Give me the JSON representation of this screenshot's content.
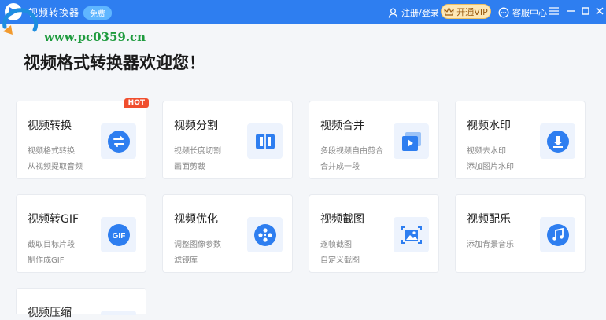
{
  "titlebar": {
    "app_title": "视频转换器",
    "version_badge": "免费",
    "login_label": "注册/登录",
    "vip_label": "开通VIP",
    "service_label": "客服中心",
    "bg_color": "#2e7ef0"
  },
  "watermark": {
    "text": "www.pc0359.cn"
  },
  "main": {
    "welcome": "视频格式转换器欢迎您！",
    "cards": [
      {
        "title": "视频转换",
        "desc1": "视频格式转换",
        "desc2": "从视频提取音频",
        "icon": "convert-icon",
        "hot": "HOT"
      },
      {
        "title": "视频分割",
        "desc1": "视频长度切割",
        "desc2": "画面剪裁",
        "icon": "split-icon"
      },
      {
        "title": "视频合并",
        "desc1": "多段视频自由剪合",
        "desc2": "合并成一段",
        "icon": "merge-icon"
      },
      {
        "title": "视频水印",
        "desc1": "视频去水印",
        "desc2": "添加图片水印",
        "icon": "watermark-icon"
      },
      {
        "title": "视频转GIF",
        "desc1": "截取目标片段",
        "desc2": "制作成GIF",
        "icon": "gif-icon",
        "icon_text": "GIF"
      },
      {
        "title": "视频优化",
        "desc1": "调整图像参数",
        "desc2": "滤镜库",
        "icon": "film-reel-icon"
      },
      {
        "title": "视频截图",
        "desc1": "逐帧截图",
        "desc2": "自定义截图",
        "icon": "screenshot-icon"
      },
      {
        "title": "视频配乐",
        "desc1": "添加背景音乐",
        "desc2": "",
        "icon": "music-icon"
      },
      {
        "title": "视频压缩",
        "desc1": "",
        "desc2": "",
        "icon": "compress-icon"
      }
    ]
  }
}
